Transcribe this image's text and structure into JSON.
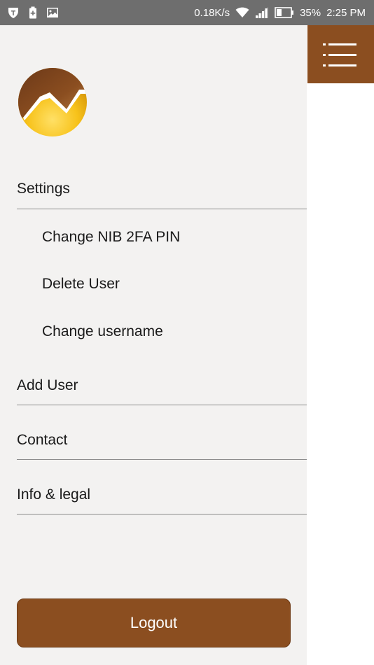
{
  "status_bar": {
    "net_speed": "0.18K/s",
    "battery": "35%",
    "time": "2:25 PM",
    "left_icons": [
      "shield-icon",
      "battery-saver-icon",
      "image-icon"
    ],
    "right_icons": [
      "wifi-icon",
      "signal-icon",
      "battery-icon"
    ]
  },
  "drawer": {
    "logo_icon": "app-logo",
    "sections": {
      "settings": "Settings",
      "add_user": "Add User",
      "contact": "Contact",
      "info_legal": "Info & legal"
    },
    "settings_sub": {
      "change_pin": "Change NIB 2FA PIN",
      "delete_user": "Delete User",
      "change_username": "Change username"
    },
    "logout_label": "Logout"
  },
  "menu_button": {
    "icon": "hamburger-menu-icon"
  },
  "colors": {
    "accent": "#8b4e20",
    "drawer_bg": "#f3f2f1",
    "status_bar": "#6e6e6e"
  }
}
